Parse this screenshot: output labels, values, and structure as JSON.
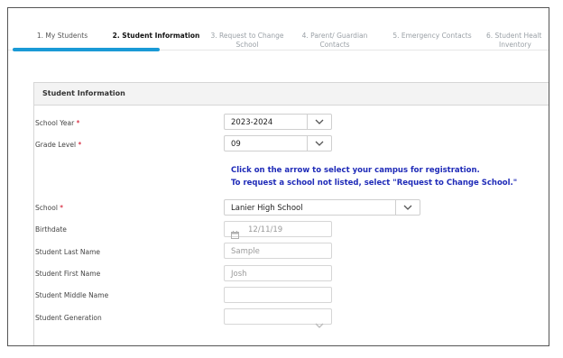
{
  "steps": [
    {
      "label_line1": "1. My Students",
      "label_line2": "",
      "state": "done"
    },
    {
      "label_line1": "2. Student Information",
      "label_line2": "",
      "state": "active"
    },
    {
      "label_line1": "3. Request to Change",
      "label_line2": "School",
      "state": "pending"
    },
    {
      "label_line1": "4. Parent/ Guardian",
      "label_line2": "Contacts",
      "state": "pending"
    },
    {
      "label_line1": "5. Emergency Contacts",
      "label_line2": "",
      "state": "pending"
    },
    {
      "label_line1": "6. Student Healt",
      "label_line2": "Inventory",
      "state": "pending"
    }
  ],
  "progress_fraction": 0.27,
  "colors": {
    "progress": "#1a9ad6",
    "required": "#d0021b",
    "note": "#1f2bb8"
  },
  "panel": {
    "title": "Student Information"
  },
  "fields": {
    "school_year": {
      "label": "School Year",
      "required_mark": "*",
      "value": "2023-2024"
    },
    "grade_level": {
      "label": "Grade Level",
      "required_mark": "*",
      "value": "09"
    },
    "school": {
      "label": "School",
      "required_mark": "*",
      "value": "Lanier High School"
    },
    "birthdate": {
      "label": "Birthdate",
      "value": "12/11/19"
    },
    "last_name": {
      "label": "Student Last Name",
      "value": "Sample"
    },
    "first_name": {
      "label": "Student First Name",
      "value": "Josh"
    },
    "middle_name": {
      "label": "Student Middle Name",
      "value": ""
    },
    "generation": {
      "label": "Student Generation",
      "value": ""
    }
  },
  "note": {
    "line1": "Click on the arrow to select your campus for registration.",
    "line2": "To request a school not listed, select \"Request to Change School.\""
  },
  "icons": {
    "dropdown": "chevron-down-icon",
    "calendar": "calendar-icon"
  }
}
